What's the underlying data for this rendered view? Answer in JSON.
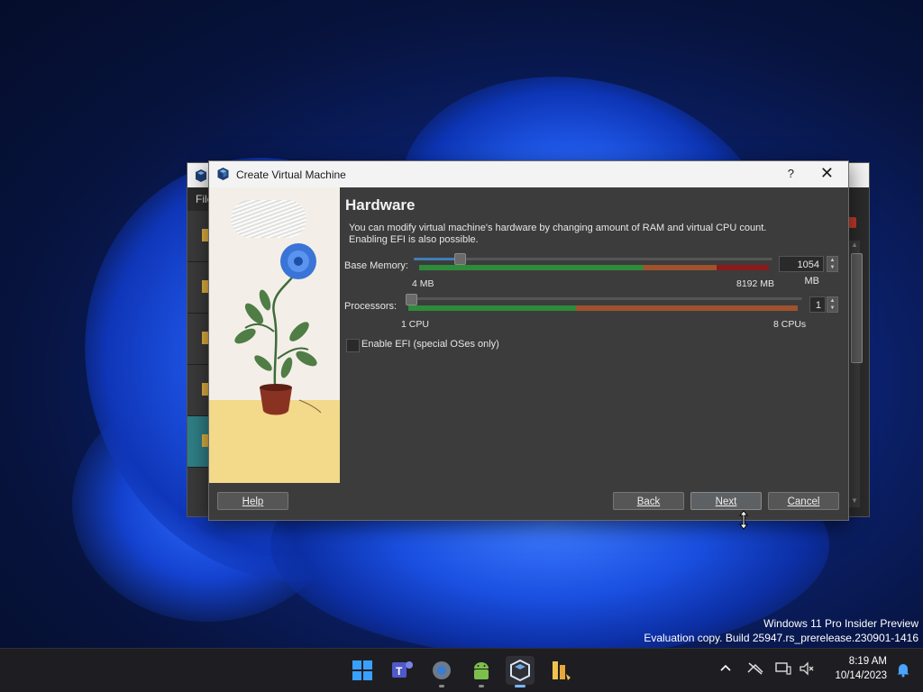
{
  "background_window": {
    "menu_first": "File"
  },
  "dialog": {
    "title": "Create Virtual Machine",
    "help_glyph": "?",
    "close_glyph": "✕",
    "heading": "Hardware",
    "description_line1": "You can modify virtual machine's hardware by changing amount of RAM and virtual CPU count.",
    "description_line2": "Enabling EFI is also possible.",
    "memory": {
      "label": "Base Memory:",
      "value": "1054 MB",
      "min_label": "4 MB",
      "max_label": "8192 MB",
      "fraction": 0.128
    },
    "processors": {
      "label": "Processors:",
      "value": "1",
      "min_label": "1 CPU",
      "max_label": "8 CPUs",
      "fraction": 0.0
    },
    "efi": {
      "label": "Enable EFI (special OSes only)",
      "checked": false
    },
    "buttons": {
      "help": "Help",
      "back": "Back",
      "next": "Next",
      "cancel": "Cancel"
    }
  },
  "watermark": {
    "line1": "Windows 11 Pro Insider Preview",
    "line2": "Evaluation copy. Build 25947.rs_prerelease.230901-1416"
  },
  "taskbar": {
    "apps": [
      "windows-start-icon",
      "teams-icon",
      "settings-icon",
      "android-icon",
      "virtualbox-icon",
      "files-app-icon"
    ],
    "time": "8:19 AM",
    "date": "10/14/2023"
  },
  "colors": {
    "dialog_bg": "#3c3c3c",
    "slider_blue": "#3e7fb8",
    "grade_green": "#2e8b3a",
    "grade_orange": "#a0522d",
    "grade_red": "#8b1a1a",
    "taskbar_bg": "#1e1e22"
  }
}
